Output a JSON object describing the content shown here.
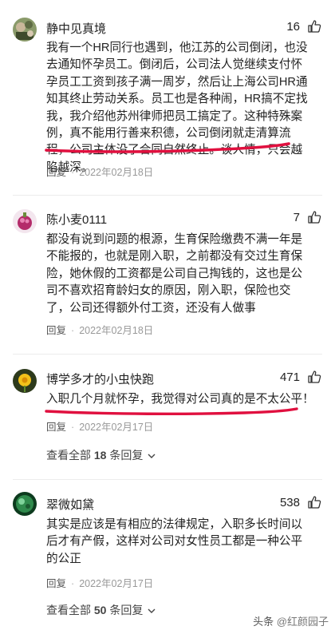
{
  "comments": [
    {
      "user": "静中见真境",
      "likes": "16",
      "text": "我有一个HR同行也遇到，他江苏的公司倒闭，也没去通知怀孕员工。倒闭后，公司法人觉继续支付怀孕员工工资到孩子满一周岁，然后让上海公司HR通知其终止劳动关系。员工也是各种闹，HR搞不定找我，我介绍他苏州律师把员工搞定了。这种特殊案例，真不能用行善来积德，公司倒闭就走清算流程，公司主体没了合同自然终止。谈人情，只会越陷越深。",
      "reply": "回复",
      "date": "2022年02月18日"
    },
    {
      "user": "陈小麦0111",
      "likes": "7",
      "text": "都没有说到问题的根源，生育保险缴费不满一年是不能报的，也就是刚入职，之前都没有交过生育保险，她休假的工资都是公司自己掏钱的，这也是公司不喜欢招育龄妇女的原因，刚入职，保险也交了，公司还得额外付工资，还没有人做事",
      "reply": "回复",
      "date": "2022年02月18日"
    },
    {
      "user": "博学多才的小虫快跑",
      "likes": "471",
      "text": "入职几个月就怀孕，我觉得对公司真的是不太公平！",
      "reply": "回复",
      "date": "2022年02月17日",
      "view_all": {
        "prefix": "查看全部 ",
        "count": "18",
        "suffix": " 条回复"
      }
    },
    {
      "user": "翠微如黛",
      "likes": "538",
      "text": "其实是应该是有相应的法律规定，入职多长时间以后才有产假，这样对公司对女性员工都是一种公平的公正",
      "reply": "回复",
      "date": "2022年02月17日",
      "view_all": {
        "prefix": "查看全部 ",
        "count": "50",
        "suffix": " 条回复"
      }
    }
  ],
  "watermark": {
    "prefix": "头条",
    "handle": "@红颜园子"
  },
  "colors": {
    "highlight": "#e0103f",
    "date": "#999999"
  }
}
